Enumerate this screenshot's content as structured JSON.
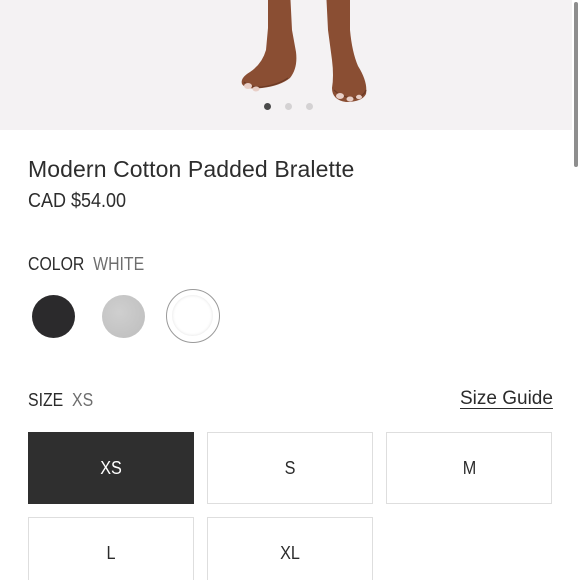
{
  "gallery": {
    "image": "product-photo-feet",
    "dots_total": 3,
    "active_dot": 1
  },
  "product": {
    "title": "Modern Cotton Padded Bralette",
    "price": "CAD $54.00"
  },
  "color": {
    "label": "COLOR",
    "selected": "WHITE",
    "swatches": [
      {
        "name": "Black",
        "hex": "#2b2a2c",
        "selected": false
      },
      {
        "name": "Grey",
        "hex": "#c6c6c6",
        "selected": false
      },
      {
        "name": "White",
        "hex": "#ffffff",
        "selected": true
      }
    ]
  },
  "size": {
    "label": "SIZE",
    "selected": "XS",
    "guide_label": "Size Guide",
    "options": [
      "XS",
      "S",
      "M",
      "L",
      "XL"
    ]
  },
  "colors": {
    "selected_button_bg": "#2f2f2f",
    "gallery_bg": "#f4f2f3"
  }
}
